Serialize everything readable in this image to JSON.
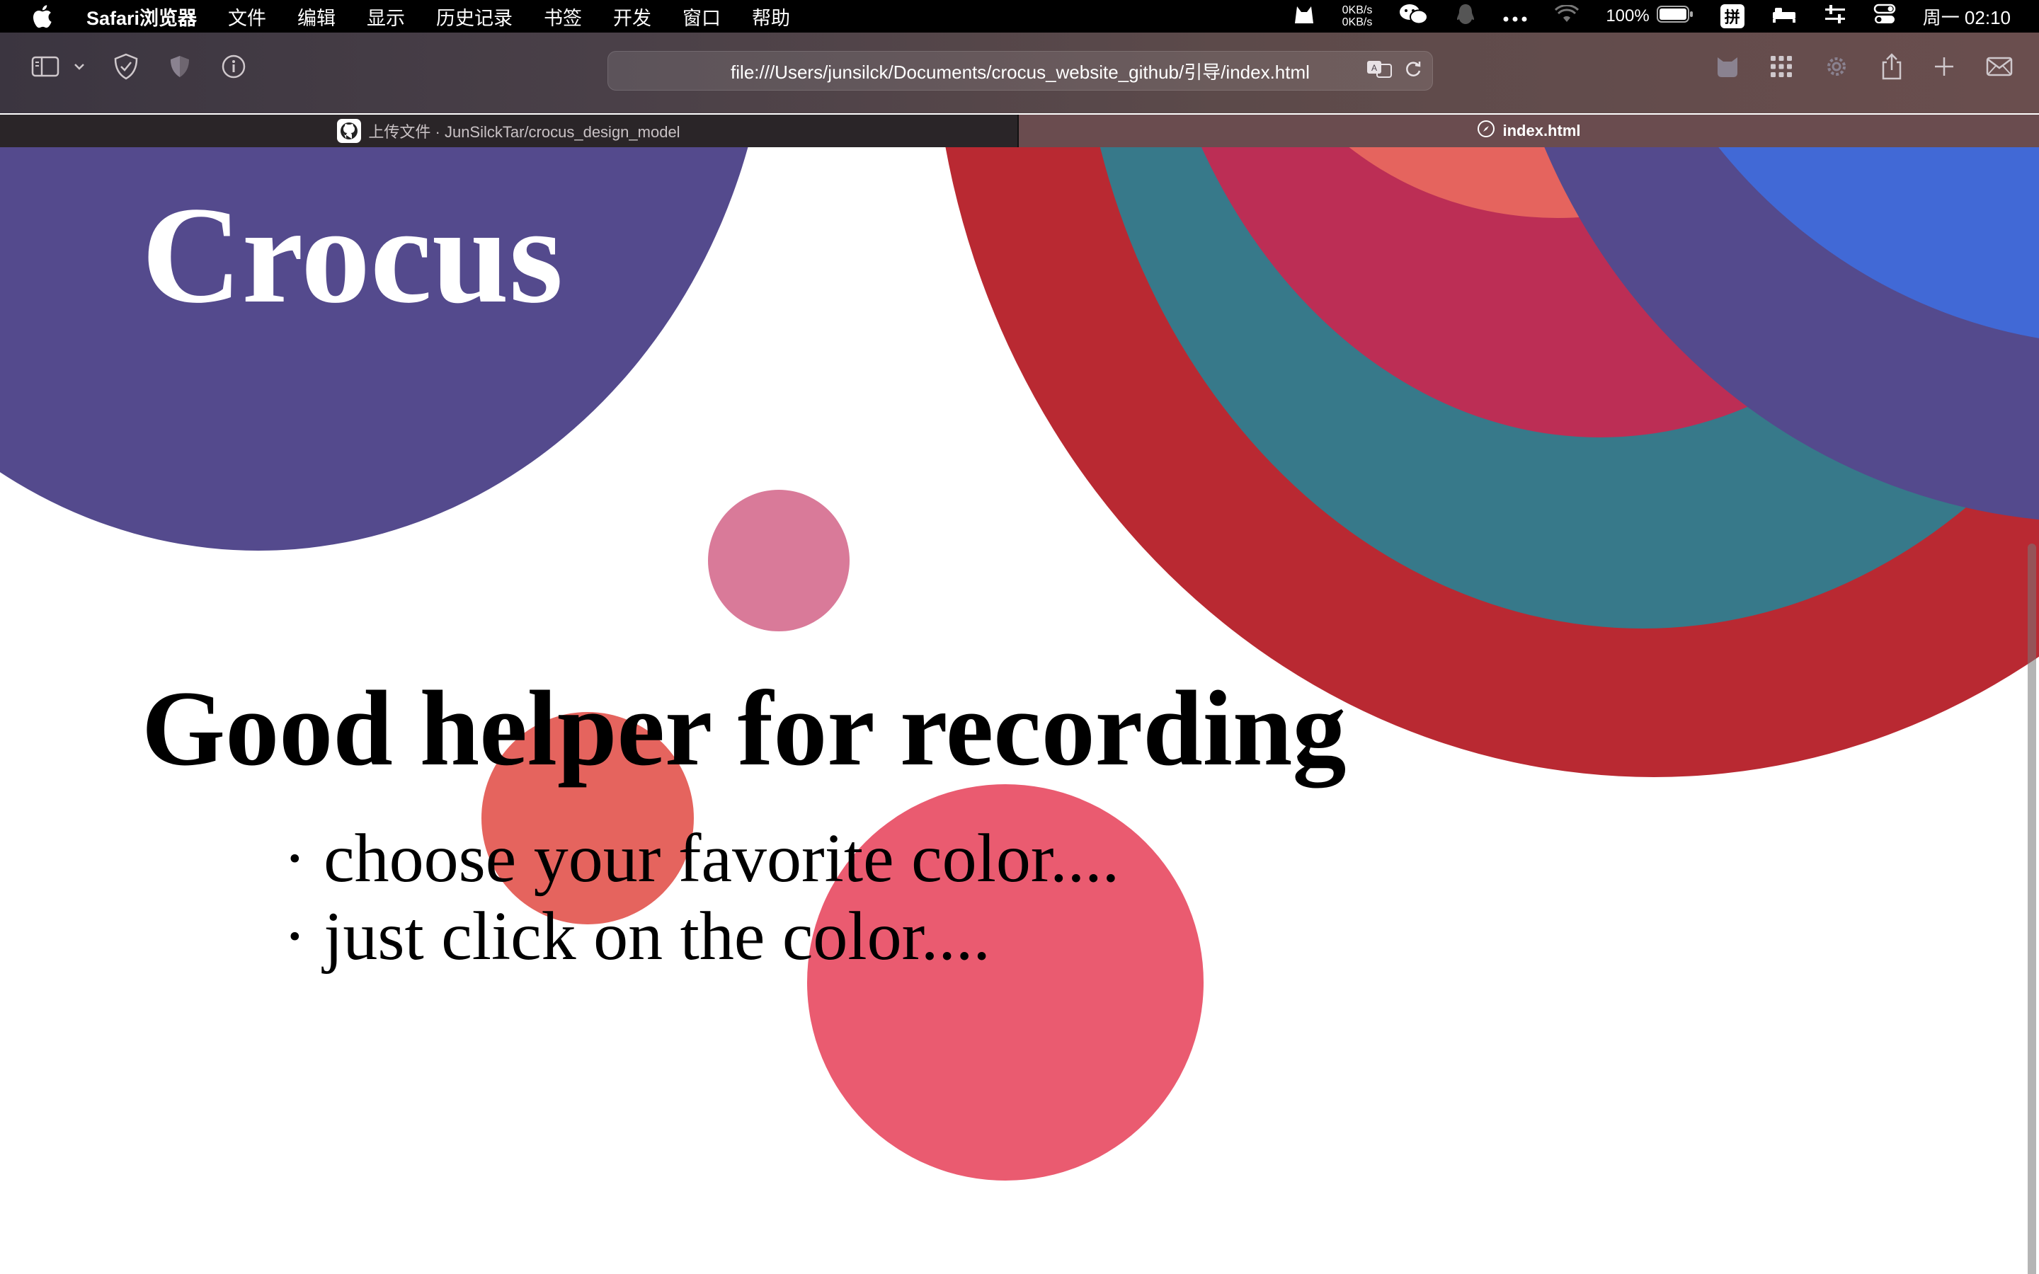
{
  "menubar": {
    "app_name": "Safari浏览器",
    "items": [
      "文件",
      "编辑",
      "显示",
      "历史记录",
      "书签",
      "开发",
      "窗口",
      "帮助"
    ],
    "net_up": "0KB/s",
    "net_down": "0KB/s",
    "battery": "100%",
    "input_method": "拼",
    "clock": "周一 02:10"
  },
  "toolbar": {
    "url": "file:///Users/junsilck/Documents/crocus_website_github/引导/index.html"
  },
  "tabs": [
    {
      "label": "上传文件 · JunSilckTar/crocus_design_model",
      "active": false
    },
    {
      "label": "index.html",
      "active": true
    }
  ],
  "page": {
    "title": "Crocus",
    "heading": "Good helper for recording",
    "bullets": [
      "· choose your favorite color....",
      "· just click on the color...."
    ]
  },
  "colors": {
    "purple": "#544a8d",
    "red": "#b92932",
    "teal": "#37798a",
    "crimson": "#bc2e55",
    "blue": "#4169d6",
    "coral": "#e5645e",
    "pink": "#d97a99",
    "rose": "#ea5b70"
  }
}
